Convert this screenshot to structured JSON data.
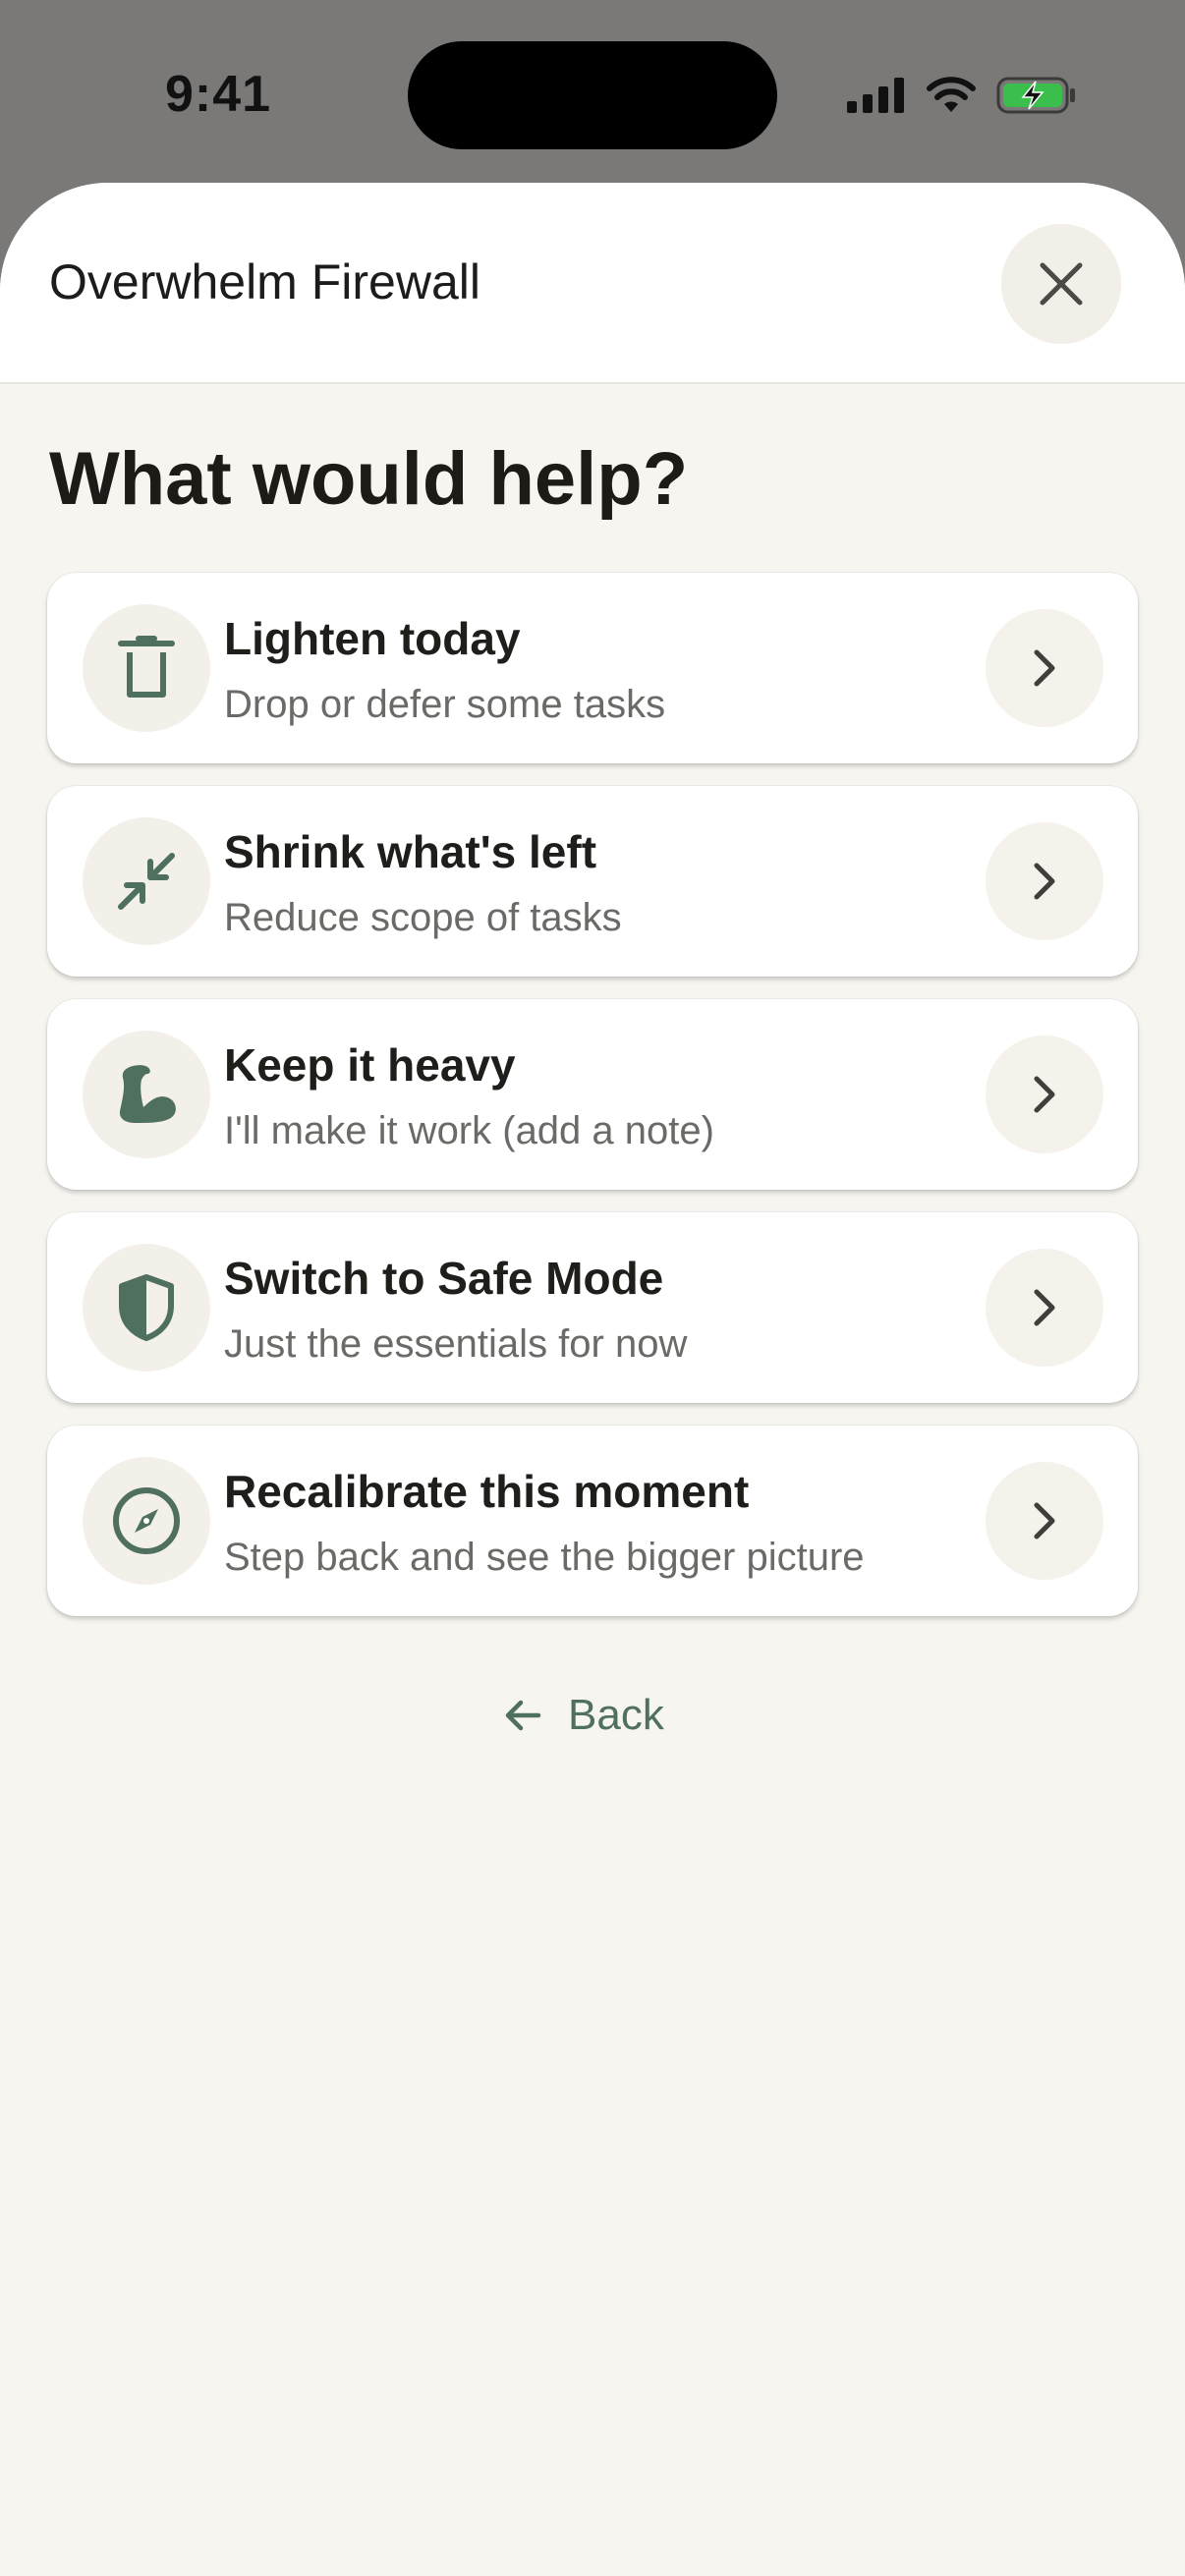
{
  "status_bar": {
    "time": "9:41",
    "icons": [
      "cellular-signal-icon",
      "wifi-icon",
      "battery-charging-icon"
    ]
  },
  "sheet": {
    "title": "Overwhelm Firewall",
    "close_icon": "close-icon"
  },
  "main": {
    "heading": "What would help?",
    "options": [
      {
        "icon": "trash-icon",
        "title": "Lighten today",
        "subtitle": "Drop or defer some tasks"
      },
      {
        "icon": "shrink-arrows-icon",
        "title": "Shrink what's left",
        "subtitle": "Reduce scope of tasks"
      },
      {
        "icon": "flexed-bicep-icon",
        "title": "Keep it heavy",
        "subtitle": "I'll make it work (add a note)"
      },
      {
        "icon": "shield-icon",
        "title": "Switch to Safe Mode",
        "subtitle": "Just the essentials for now"
      },
      {
        "icon": "compass-icon",
        "title": "Recalibrate this moment",
        "subtitle": "Step back and see the bigger picture"
      }
    ],
    "back_label": "Back"
  },
  "colors": {
    "accent": "#4f705e",
    "sheet_bg": "#f7f5f0",
    "card_bg": "#ffffff",
    "backdrop": "#7a7978"
  }
}
